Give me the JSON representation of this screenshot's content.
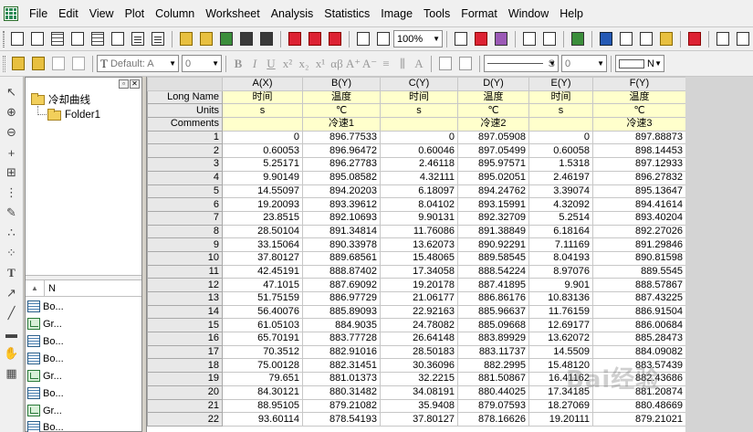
{
  "menu": [
    "File",
    "Edit",
    "View",
    "Plot",
    "Column",
    "Worksheet",
    "Analysis",
    "Statistics",
    "Image",
    "Tools",
    "Format",
    "Window",
    "Help"
  ],
  "toolbar": {
    "zoom": "100%",
    "font": "Default: A",
    "font_size": "0",
    "line_style_value": "S",
    "line_width": "0",
    "fill_label": "N"
  },
  "explorer": {
    "root": "冷却曲线",
    "folder": "Folder1",
    "list_header": "N",
    "items": [
      {
        "type": "worksheet",
        "label": "Bo..."
      },
      {
        "type": "graph",
        "label": "Gr..."
      },
      {
        "type": "worksheet",
        "label": "Bo..."
      },
      {
        "type": "worksheet",
        "label": "Bo..."
      },
      {
        "type": "graph",
        "label": "Gr..."
      },
      {
        "type": "worksheet",
        "label": "Bo..."
      },
      {
        "type": "graph",
        "label": "Gr..."
      },
      {
        "type": "worksheet",
        "label": "Bo..."
      }
    ]
  },
  "sheet": {
    "columns": [
      "A(X)",
      "B(Y)",
      "C(Y)",
      "D(Y)",
      "E(Y)",
      "F(Y)"
    ],
    "row_labels": {
      "long_name": "Long Name",
      "units": "Units",
      "comments": "Comments"
    },
    "long_name": [
      "时间",
      "温度",
      "时间",
      "温度",
      "时间",
      "温度"
    ],
    "units": [
      "s",
      "℃",
      "s",
      "℃",
      "s",
      "℃"
    ],
    "comments": [
      "",
      "冷速1",
      "",
      "冷速2",
      "",
      "冷速3"
    ],
    "rows": [
      [
        "1",
        "0",
        "896.77533",
        "0",
        "897.05908",
        "0",
        "897.88873"
      ],
      [
        "2",
        "0.60053",
        "896.96472",
        "0.60046",
        "897.05499",
        "0.60058",
        "898.14453"
      ],
      [
        "3",
        "5.25171",
        "896.27783",
        "2.46118",
        "895.97571",
        "1.5318",
        "897.12933"
      ],
      [
        "4",
        "9.90149",
        "895.08582",
        "4.32111",
        "895.02051",
        "2.46197",
        "896.27832"
      ],
      [
        "5",
        "14.55097",
        "894.20203",
        "6.18097",
        "894.24762",
        "3.39074",
        "895.13647"
      ],
      [
        "6",
        "19.20093",
        "893.39612",
        "8.04102",
        "893.15991",
        "4.32092",
        "894.41614"
      ],
      [
        "7",
        "23.8515",
        "892.10693",
        "9.90131",
        "892.32709",
        "5.2514",
        "893.40204"
      ],
      [
        "8",
        "28.50104",
        "891.34814",
        "11.76086",
        "891.38849",
        "6.18164",
        "892.27026"
      ],
      [
        "9",
        "33.15064",
        "890.33978",
        "13.62073",
        "890.92291",
        "7.11169",
        "891.29846"
      ],
      [
        "10",
        "37.80127",
        "889.68561",
        "15.48065",
        "889.58545",
        "8.04193",
        "890.81598"
      ],
      [
        "11",
        "42.45191",
        "888.87402",
        "17.34058",
        "888.54224",
        "8.97076",
        "889.5545"
      ],
      [
        "12",
        "47.1015",
        "887.69092",
        "19.20178",
        "887.41895",
        "9.901",
        "888.57867"
      ],
      [
        "13",
        "51.75159",
        "886.97729",
        "21.06177",
        "886.86176",
        "10.83136",
        "887.43225"
      ],
      [
        "14",
        "56.40076",
        "885.89093",
        "22.92163",
        "885.96637",
        "11.76159",
        "886.91504"
      ],
      [
        "15",
        "61.05103",
        "884.9035",
        "24.78082",
        "885.09668",
        "12.69177",
        "886.00684"
      ],
      [
        "16",
        "65.70191",
        "883.77728",
        "26.64148",
        "883.89929",
        "13.62072",
        "885.28473"
      ],
      [
        "17",
        "70.3512",
        "882.91016",
        "28.50183",
        "883.11737",
        "14.5509",
        "884.09082"
      ],
      [
        "18",
        "75.00128",
        "882.31451",
        "30.36096",
        "882.2995",
        "15.48120",
        "883.57439"
      ],
      [
        "19",
        "79.651",
        "881.01373",
        "32.2215",
        "881.50867",
        "16.41162",
        "882.43686"
      ],
      [
        "20",
        "84.30121",
        "880.31482",
        "34.08191",
        "880.44025",
        "17.34185",
        "881.20874"
      ],
      [
        "21",
        "88.95105",
        "879.21082",
        "35.9408",
        "879.07593",
        "18.27069",
        "880.48669"
      ],
      [
        "22",
        "93.60114",
        "878.54193",
        "37.80127",
        "878.16626",
        "19.20111",
        "879.21021"
      ]
    ]
  },
  "watermark": "Bai经验"
}
